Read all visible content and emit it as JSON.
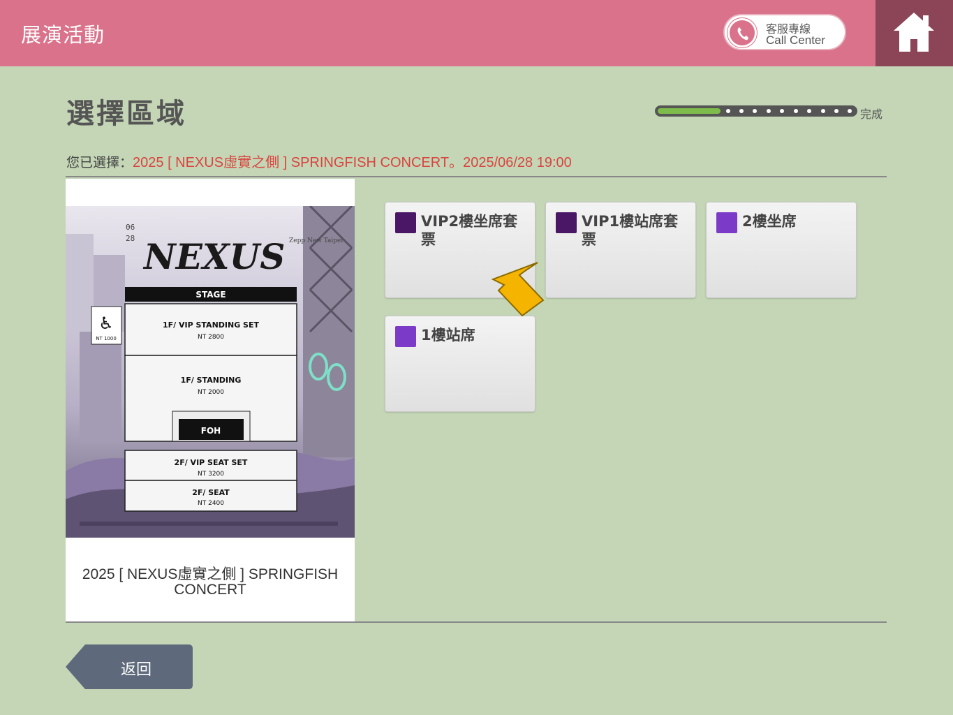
{
  "header": {
    "title": "展演活動",
    "call_center_zh": "客服專線",
    "call_center_en": "Call Center"
  },
  "page": {
    "title": "選擇區域",
    "progress_label": "完成",
    "progress_fraction": 0.32
  },
  "selection": {
    "prefix": "您已選擇：",
    "value": "2025 [ NEXUS虛實之側 ] SPRINGFISH CONCERT。2025/06/28 19:00"
  },
  "event": {
    "name": "2025 [ NEXUS虛實之側 ] SPRINGFISH CONCERT",
    "poster": {
      "logo": "NEXUS",
      "date_month": "06",
      "date_day": "28",
      "venue": "Zepp New Taipei",
      "stage": "STAGE",
      "accessible_price": "NT 1000",
      "foh": "FOH",
      "sections": [
        {
          "name": "1F/ VIP STANDING SET",
          "price": "NT 2800"
        },
        {
          "name": "1F/ STANDING",
          "price": "NT 2000"
        },
        {
          "name": "2F/ VIP SEAT SET",
          "price": "NT 3200"
        },
        {
          "name": "2F/ SEAT",
          "price": "NT 2400"
        }
      ]
    }
  },
  "zones": [
    {
      "label": "VIP2樓坐席套票",
      "color": "#4a1766"
    },
    {
      "label": "VIP1樓站席套票",
      "color": "#4a1766"
    },
    {
      "label": "2樓坐席",
      "color": "#7b3bc8"
    },
    {
      "label": "1樓站席",
      "color": "#7b3bc8"
    }
  ],
  "footer": {
    "back_label": "返回"
  },
  "colors": {
    "header": "#d9728a",
    "home": "#8b4556",
    "background": "#c4d6b6",
    "accent_text": "#d9443f",
    "back_button": "#5e6a7c",
    "pointer": "#f5b400"
  }
}
